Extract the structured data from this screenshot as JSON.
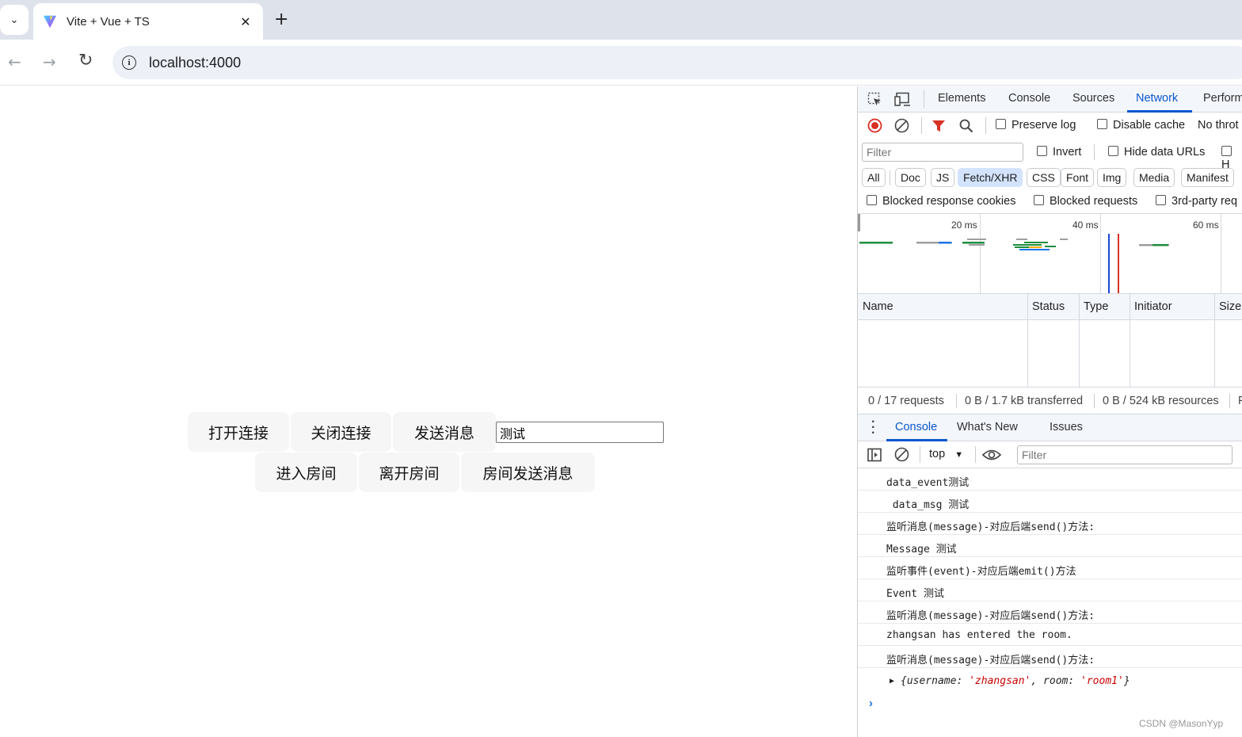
{
  "browser": {
    "tab_title": "Vite + Vue + TS",
    "tab_close": "✕",
    "new_tab": "+",
    "url": "localhost:4000"
  },
  "page": {
    "row1": [
      "打开连接",
      "关闭连接",
      "发送消息"
    ],
    "input_value": "测试",
    "row2": [
      "进入房间",
      "离开房间",
      "房间发送消息"
    ]
  },
  "devtools": {
    "tabs": [
      "Elements",
      "Console",
      "Sources",
      "Network",
      "Perform"
    ],
    "active_tab": "Network",
    "toolbar": {
      "preserve_log": "Preserve log",
      "disable_cache": "Disable cache",
      "throttle": "No throt"
    },
    "filter_placeholder": "Filter",
    "invert": "Invert",
    "hide_data_urls": "Hide data URLs",
    "chips": [
      "All",
      "Doc",
      "JS",
      "Fetch/XHR",
      "CSS",
      "Font",
      "Img",
      "Media",
      "Manifest"
    ],
    "active_chip": "Fetch/XHR",
    "blocked_cookies": "Blocked response cookies",
    "blocked_requests": "Blocked requests",
    "third_party": "3rd-party req",
    "overview_labels": [
      "20 ms",
      "40 ms",
      "60 ms"
    ],
    "columns": [
      "Name",
      "Status",
      "Type",
      "Initiator",
      "Size"
    ],
    "status": {
      "requests": "0 / 17 requests",
      "transferred": "0 B / 1.7 kB transferred",
      "resources": "0 B / 524 kB resources"
    },
    "drawer_tabs": [
      "Console",
      "What's New",
      "Issues"
    ],
    "console_context": "top",
    "console_filter_placeholder": "Filter",
    "console_lines": [
      "data_event测试",
      " data_msg 测试",
      "监听消息(message)-对应后端send()方法:",
      "Message 测试",
      "监听事件(event)-对应后端emit()方法",
      "Event 测试",
      "监听消息(message)-对应后端send()方法:",
      "zhangsan has entered the room.",
      "监听消息(message)-对应后端send()方法:"
    ],
    "object_line": {
      "key1": "username",
      "val1": "'zhangsan'",
      "key2": "room",
      "val2": "'room1'"
    }
  },
  "watermark": "CSDN @MasonYyp"
}
